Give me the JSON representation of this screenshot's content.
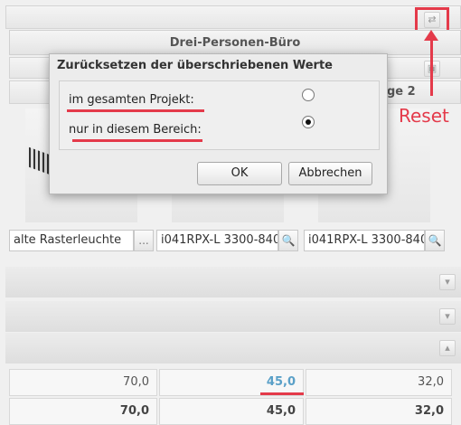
{
  "panel": {
    "title": "Drei-Personen-Büro",
    "partial_header": "ge 2"
  },
  "reset_annotation": {
    "label": "Reset",
    "color": "#e43a4a"
  },
  "luminaires": [
    {
      "value": "alte Rasterleuchte",
      "button_icon": "ellipsis-icon",
      "button_glyph": "..."
    },
    {
      "value": "i041RPX-L 3300-840",
      "button_icon": "search-icon",
      "button_glyph": "🔍"
    },
    {
      "value": "i041RPX-L 3300-840",
      "button_icon": "search-icon",
      "button_glyph": "🔍"
    }
  ],
  "results": {
    "row1": [
      "70,0",
      "45,0",
      "32,0"
    ],
    "row2": [
      "70,0",
      "45,0",
      "32,0"
    ]
  },
  "dialog": {
    "title": "Zurücksetzen der überschriebenen Werte",
    "option_project": "im gesamten Projekt:",
    "option_area": "nur in diesem Bereich:",
    "selected": "option_area",
    "ok_label": "OK",
    "cancel_label": "Abbrechen"
  }
}
